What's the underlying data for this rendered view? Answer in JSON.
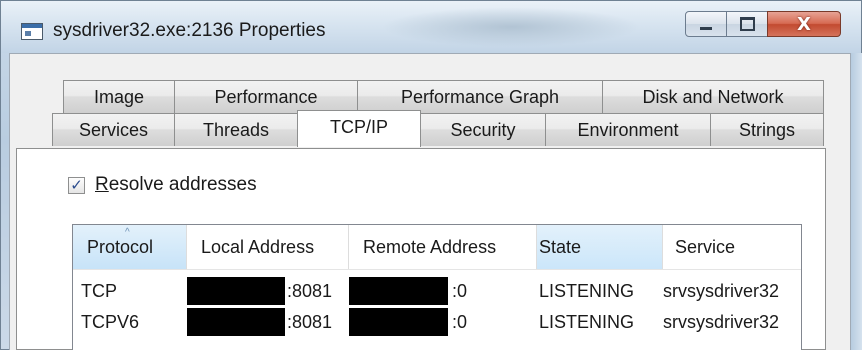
{
  "window": {
    "title": "sysdriver32.exe:2136 Properties",
    "close_glyph": "X",
    "icons": {
      "app": "app-window-icon",
      "minimize": "minimize-icon",
      "maximize": "maximize-icon",
      "close": "close-icon"
    }
  },
  "tabs": {
    "row1": [
      "Image",
      "Performance",
      "Performance Graph",
      "Disk and Network"
    ],
    "row2": [
      "Services",
      "Threads",
      "TCP/IP",
      "Security",
      "Environment",
      "Strings"
    ],
    "active": "TCP/IP"
  },
  "resolve": {
    "checked": true,
    "check_glyph": "✓",
    "label_first": "R",
    "label_rest": "esolve addresses"
  },
  "table": {
    "columns": [
      "Protocol",
      "Local Address",
      "Remote Address",
      "State",
      "Service"
    ],
    "sorted_column": "Protocol",
    "sort_glyph": "^",
    "rows": [
      {
        "protocol": "TCP",
        "local": ":8081",
        "remote": ":0",
        "state": "LISTENING",
        "service": "srvsysdriver32"
      },
      {
        "protocol": "TCPV6",
        "local": ":8081",
        "remote": ":0",
        "state": "LISTENING",
        "service": "srvsysdriver32"
      }
    ]
  },
  "colors": {
    "accent": "#c7e3f8",
    "close_button": "#c24a30",
    "redaction": "#000000"
  }
}
